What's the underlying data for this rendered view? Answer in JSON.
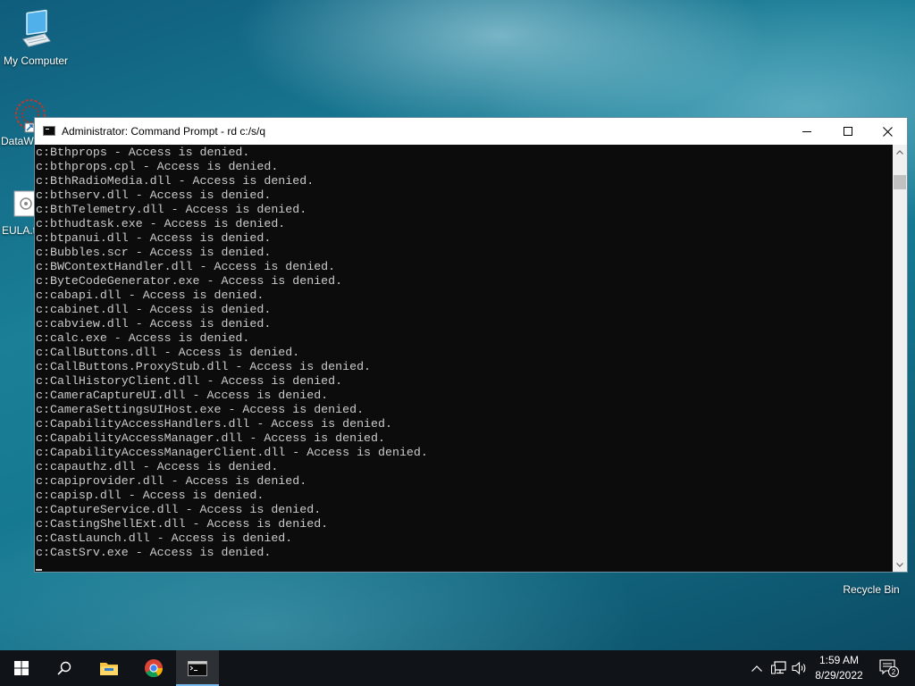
{
  "desktop": {
    "icons": [
      {
        "label": "My Computer"
      },
      {
        "label": "DataW"
      },
      {
        "label": "EULA.t"
      },
      {
        "label": "Recycle Bin"
      }
    ]
  },
  "window": {
    "title": "Administrator: Command Prompt - rd  c:/s/q",
    "icons": {
      "app": "cmd-icon",
      "minimize": "minimize-icon",
      "maximize": "maximize-icon",
      "close": "close-icon"
    }
  },
  "console": {
    "lines": [
      "c:Bthprops - Access is denied.",
      "c:bthprops.cpl - Access is denied.",
      "c:BthRadioMedia.dll - Access is denied.",
      "c:bthserv.dll - Access is denied.",
      "c:BthTelemetry.dll - Access is denied.",
      "c:bthudtask.exe - Access is denied.",
      "c:btpanui.dll - Access is denied.",
      "c:Bubbles.scr - Access is denied.",
      "c:BWContextHandler.dll - Access is denied.",
      "c:ByteCodeGenerator.exe - Access is denied.",
      "c:cabapi.dll - Access is denied.",
      "c:cabinet.dll - Access is denied.",
      "c:cabview.dll - Access is denied.",
      "c:calc.exe - Access is denied.",
      "c:CallButtons.dll - Access is denied.",
      "c:CallButtons.ProxyStub.dll - Access is denied.",
      "c:CallHistoryClient.dll - Access is denied.",
      "c:CameraCaptureUI.dll - Access is denied.",
      "c:CameraSettingsUIHost.exe - Access is denied.",
      "c:CapabilityAccessHandlers.dll - Access is denied.",
      "c:CapabilityAccessManager.dll - Access is denied.",
      "c:CapabilityAccessManagerClient.dll - Access is denied.",
      "c:capauthz.dll - Access is denied.",
      "c:capiprovider.dll - Access is denied.",
      "c:capisp.dll - Access is denied.",
      "c:CaptureService.dll - Access is denied.",
      "c:CastingShellExt.dll - Access is denied.",
      "c:CastLaunch.dll - Access is denied.",
      "c:CastSrv.exe - Access is denied."
    ]
  },
  "taskbar": {
    "items": [
      "start-icon",
      "search-icon",
      "file-explorer-icon",
      "chrome-icon",
      "command-prompt-icon"
    ],
    "tray": {
      "icons": [
        "chevron-up-icon",
        "network-icon",
        "volume-icon"
      ],
      "time": "1:59 AM",
      "date": "8/29/2022",
      "notification_count": "2"
    }
  },
  "colors": {
    "console_bg": "#0c0c0c",
    "console_fg": "#cccccc",
    "taskbar_bg": "#101418",
    "accent": "#76b9ed"
  }
}
